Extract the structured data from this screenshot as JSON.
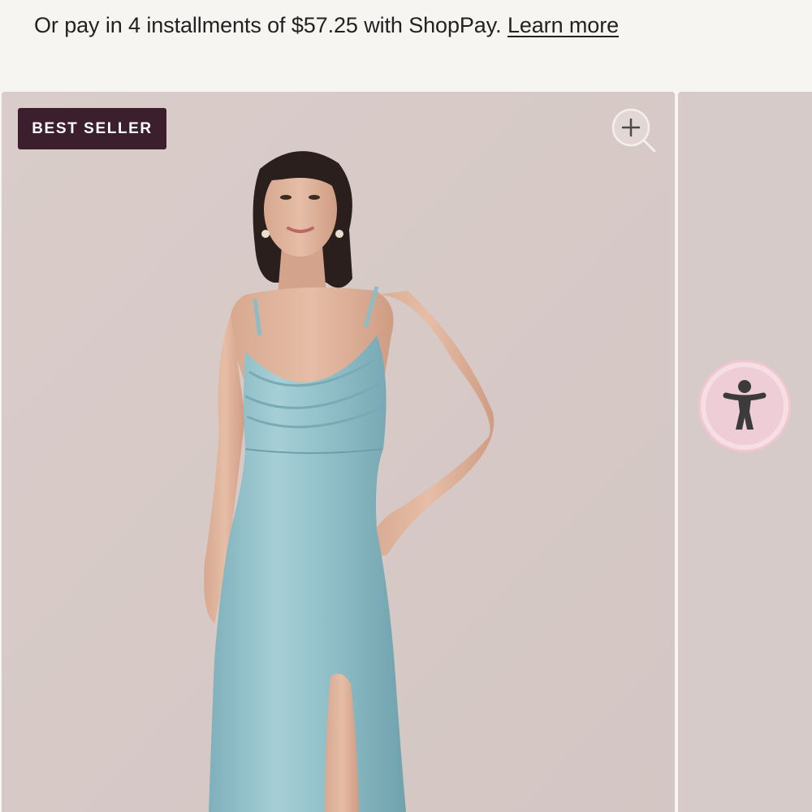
{
  "installments": {
    "text": "Or pay in 4 installments of $57.25 with ShopPay.",
    "link_label": "Learn more"
  },
  "gallery": {
    "badge_label": "BEST SELLER",
    "zoom_icon": "zoom-in-icon",
    "image_subject": "model wearing light blue satin cowl-neck maxi dress with side slit",
    "dress_color": "#8fbcc6",
    "background_color": "#d8cbc8"
  },
  "accessibility": {
    "icon": "accessibility-person-icon",
    "accent_color": "#f6dfe4"
  }
}
